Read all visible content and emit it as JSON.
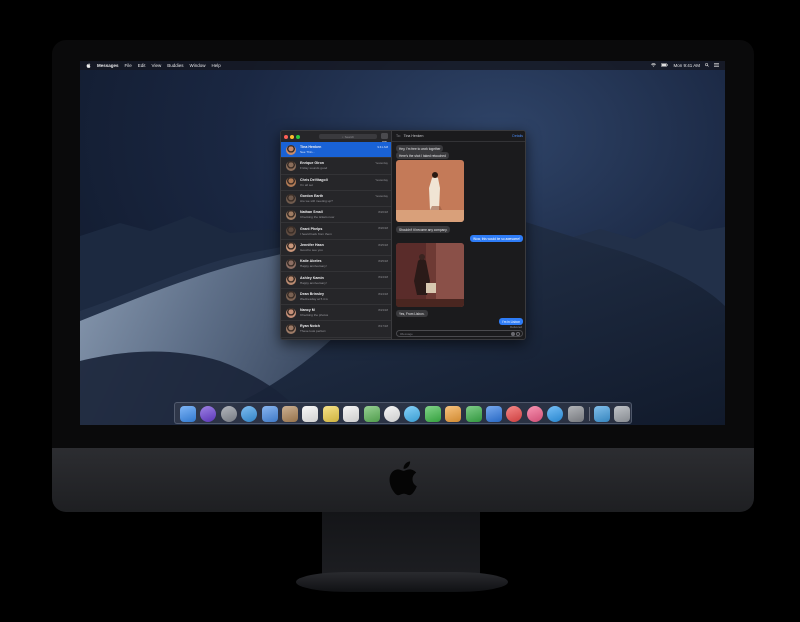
{
  "menubar": {
    "app_name": "Messages",
    "items": [
      "File",
      "Edit",
      "View",
      "Buddies",
      "Window",
      "Help"
    ],
    "clock": "Mon 9:41 AM"
  },
  "sidebar": {
    "search_placeholder": "Search",
    "conversations": [
      {
        "name": "Tina Henken",
        "preview": "See Thin...",
        "date": "9:41 AM",
        "selected": true,
        "color": "#c98a6a"
      },
      {
        "name": "Enrique Giron",
        "preview": "Friday sounds good",
        "date": "Yesterday",
        "selected": false,
        "color": "#8a6d5a"
      },
      {
        "name": "Chris DeVitagoli",
        "preview": "I'm all set",
        "date": "Yesterday",
        "selected": false,
        "color": "#b07a55"
      },
      {
        "name": "Gordon Earth",
        "preview": "Are we still meeting up?",
        "date": "Yesterday",
        "selected": false,
        "color": "#6f5a4d"
      },
      {
        "name": "Nathan Small",
        "preview": "Checking the tickets now",
        "date": "8/26/18",
        "selected": false,
        "color": "#a07c62"
      },
      {
        "name": "Grant Phelps",
        "preview": "I heard back from them",
        "date": "8/26/18",
        "selected": false,
        "color": "#5e4b40"
      },
      {
        "name": "Jennifer Hasn",
        "preview": "Good to see you",
        "date": "8/25/18",
        "selected": false,
        "color": "#c9967a"
      },
      {
        "name": "Katie Abeles",
        "preview": "Happy anniversary!",
        "date": "8/25/18",
        "selected": false,
        "color": "#8d6e63"
      },
      {
        "name": "Ashley Kamin",
        "preview": "Happy anniversary!",
        "date": "8/24/18",
        "selected": false,
        "color": "#b98a70"
      },
      {
        "name": "Dean Brinsley",
        "preview": "Wednesday at 5 it is",
        "date": "8/24/18",
        "selected": false,
        "color": "#7a6152"
      },
      {
        "name": "Nancy M",
        "preview": "Checking the photos",
        "date": "8/23/18",
        "selected": false,
        "color": "#c58f78"
      },
      {
        "name": "Ryan Notch",
        "preview": "These look perfect",
        "date": "8/17/18",
        "selected": false,
        "color": "#9c7a66"
      }
    ]
  },
  "chat": {
    "to_label": "To:",
    "recipient": "Tina Henken",
    "details_label": "Details",
    "messages": [
      {
        "dir": "in",
        "text": "Hey, I'm free to work together"
      },
      {
        "dir": "in",
        "text": "Here's the shot I taked retouched"
      },
      {
        "dir": "in",
        "text": "Shouldn't it become any company."
      },
      {
        "dir": "out",
        "text": "Wow, this would be so awesome!"
      },
      {
        "dir": "in",
        "text": "Yes, From Lisbon."
      },
      {
        "dir": "out",
        "text": "I'm in Lisbon"
      }
    ],
    "delivered_label": "Delivered",
    "input_placeholder": "iMessage"
  },
  "dock": {
    "apps": [
      {
        "name": "finder",
        "color": "#3a8ef2"
      },
      {
        "name": "siri",
        "color": "#6a3fd6"
      },
      {
        "name": "launchpad",
        "color": "#8a8f99"
      },
      {
        "name": "safari",
        "color": "#3a9ae8"
      },
      {
        "name": "mail",
        "color": "#4a8ee8"
      },
      {
        "name": "contacts",
        "color": "#b08658"
      },
      {
        "name": "calendar",
        "color": "#f4f4f4"
      },
      {
        "name": "notes",
        "color": "#f2d24a"
      },
      {
        "name": "reminders",
        "color": "#f0f0f0"
      },
      {
        "name": "maps",
        "color": "#5fb85a"
      },
      {
        "name": "photos",
        "color": "#f0f0f0"
      },
      {
        "name": "messages",
        "color": "#45b8f5"
      },
      {
        "name": "facetime",
        "color": "#3fbd4a"
      },
      {
        "name": "keynote-like",
        "color": "#f4a23a"
      },
      {
        "name": "numbers",
        "color": "#3bb24a"
      },
      {
        "name": "keynote",
        "color": "#2f7be6"
      },
      {
        "name": "news",
        "color": "#f04a4a"
      },
      {
        "name": "music",
        "color": "#f45c8a"
      },
      {
        "name": "app-store",
        "color": "#2e9df2"
      },
      {
        "name": "system-preferences",
        "color": "#8a8d93"
      },
      {
        "name": "downloads-folder",
        "color": "#3f9de0"
      },
      {
        "name": "trash",
        "color": "#9ea3aa"
      }
    ]
  }
}
